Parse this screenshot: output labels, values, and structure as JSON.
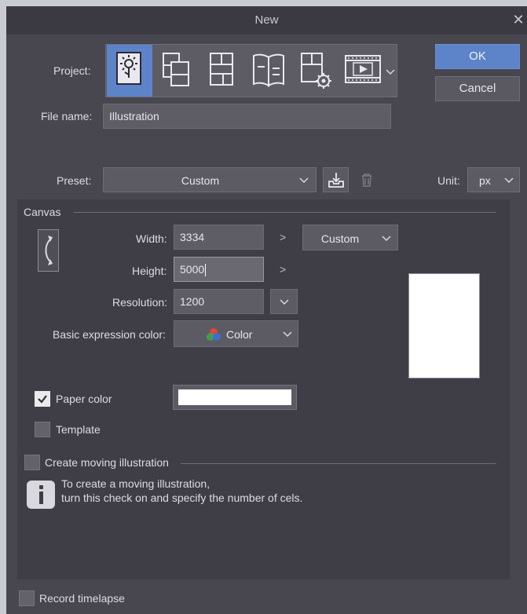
{
  "window": {
    "title": "New"
  },
  "project": {
    "label": "Project:",
    "icons": [
      "illustration-icon",
      "webtoon-icon",
      "comic-icon",
      "book-icon",
      "multi-page-settings-icon",
      "animation-icon"
    ]
  },
  "file_name": {
    "label": "File name:",
    "value": "Illustration"
  },
  "buttons": {
    "ok": "OK",
    "cancel": "Cancel"
  },
  "preset": {
    "label": "Preset:",
    "value": "Custom"
  },
  "unit": {
    "label": "Unit:",
    "value": "px"
  },
  "canvas": {
    "section_label": "Canvas",
    "width_label": "Width:",
    "width_value": "3334",
    "height_label": "Height:",
    "height_value": "5000",
    "resolution_label": "Resolution:",
    "resolution_value": "1200",
    "size_preset": "Custom",
    "expression_label": "Basic expression color:",
    "expression_value": "Color",
    "arrow_glyph": ">"
  },
  "paper_color": {
    "label": "Paper color",
    "checked": true,
    "color": "#ffffff"
  },
  "template": {
    "label": "Template",
    "checked": false
  },
  "moving_illustration": {
    "label": "Create moving illustration",
    "checked": false,
    "info_line1": "To create a moving illustration,",
    "info_line2": "turn this check on and specify the number of cels."
  },
  "record_timelapse": {
    "label": "Record timelapse",
    "checked": false
  },
  "colors": {
    "accent": "#5d84c9",
    "background": "#48474f",
    "panel": "#3f3e46"
  }
}
